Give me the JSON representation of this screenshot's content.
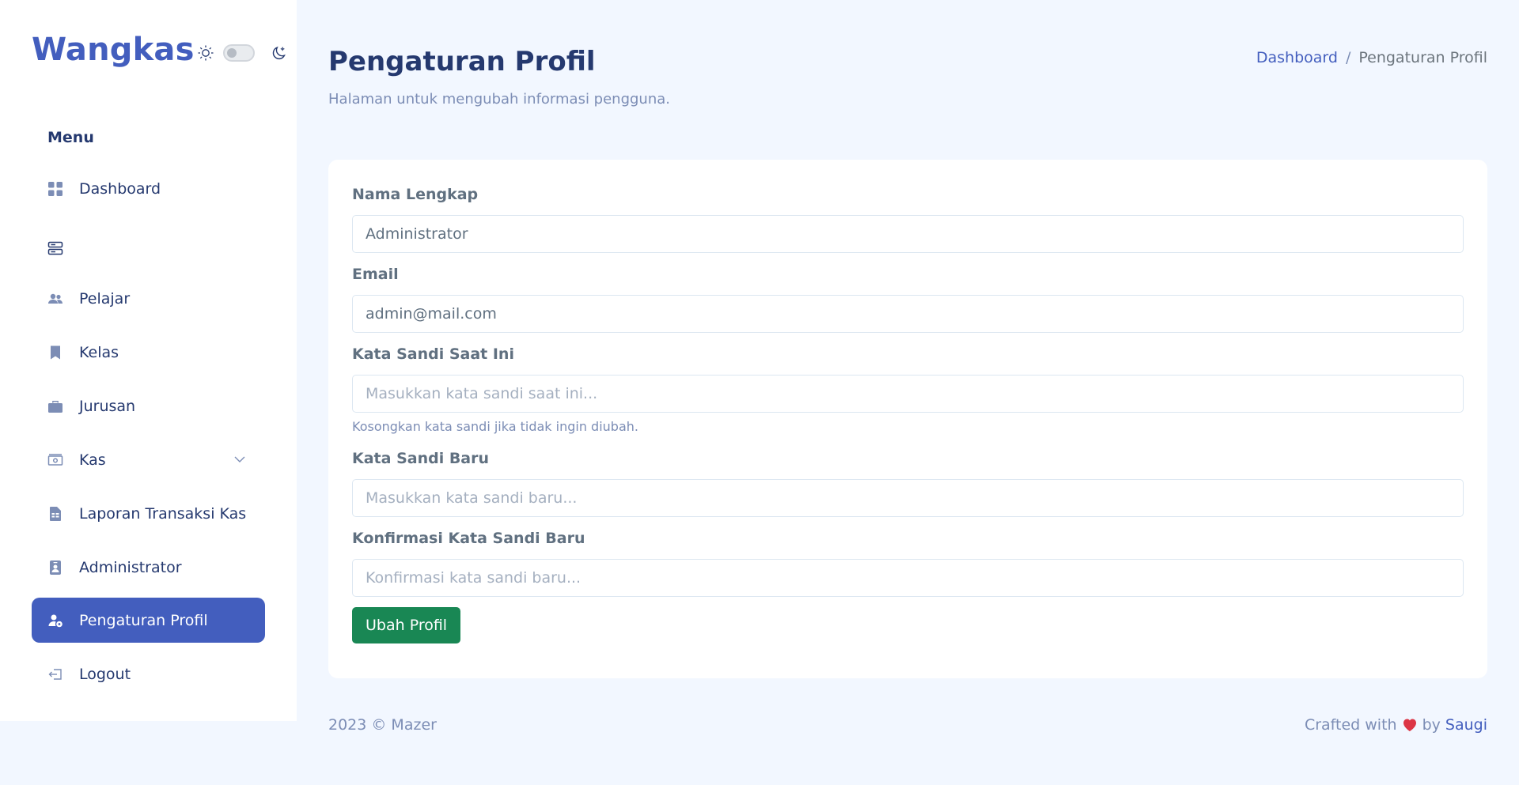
{
  "sidebar": {
    "logo": "Wangkas",
    "menu_title": "Menu",
    "items": [
      {
        "label": "Dashboard",
        "icon": "grid-icon"
      },
      {
        "label": "",
        "icon": "server-icon"
      },
      {
        "label": "Pelajar",
        "icon": "people-icon"
      },
      {
        "label": "Kelas",
        "icon": "bookmark-icon"
      },
      {
        "label": "Jurusan",
        "icon": "briefcase-icon"
      },
      {
        "label": "Kas",
        "icon": "cash-icon"
      },
      {
        "label": "Laporan Transaksi Kas",
        "icon": "file-spreadsheet-icon"
      },
      {
        "label": "Administrator",
        "icon": "person-badge-icon"
      },
      {
        "label": "Pengaturan Profil",
        "icon": "person-gear-icon",
        "active": true
      },
      {
        "label": "Logout",
        "icon": "logout-icon"
      }
    ]
  },
  "header": {
    "title": "Pengaturan Profil",
    "subtitle": "Halaman untuk mengubah informasi pengguna.",
    "breadcrumb": {
      "home": "Dashboard",
      "separator": "/",
      "current": "Pengaturan Profil"
    }
  },
  "form": {
    "name": {
      "label": "Nama Lengkap",
      "value": "Administrator"
    },
    "email": {
      "label": "Email",
      "value": "admin@mail.com"
    },
    "current_password": {
      "label": "Kata Sandi Saat Ini",
      "placeholder": "Masukkan kata sandi saat ini..."
    },
    "help_text": "Kosongkan kata sandi jika tidak ingin diubah.",
    "new_password": {
      "label": "Kata Sandi Baru",
      "placeholder": "Masukkan kata sandi baru..."
    },
    "confirm_password": {
      "label": "Konfirmasi Kata Sandi Baru",
      "placeholder": "Konfirmasi kata sandi baru..."
    },
    "submit_label": "Ubah Profil"
  },
  "footer": {
    "left": "2023 © Mazer",
    "crafted": "Crafted with",
    "by": "by",
    "author": "Saugi"
  },
  "colors": {
    "primary": "#435ebe",
    "background": "#f2f7ff",
    "success": "#198754",
    "heart": "#dc3545"
  }
}
